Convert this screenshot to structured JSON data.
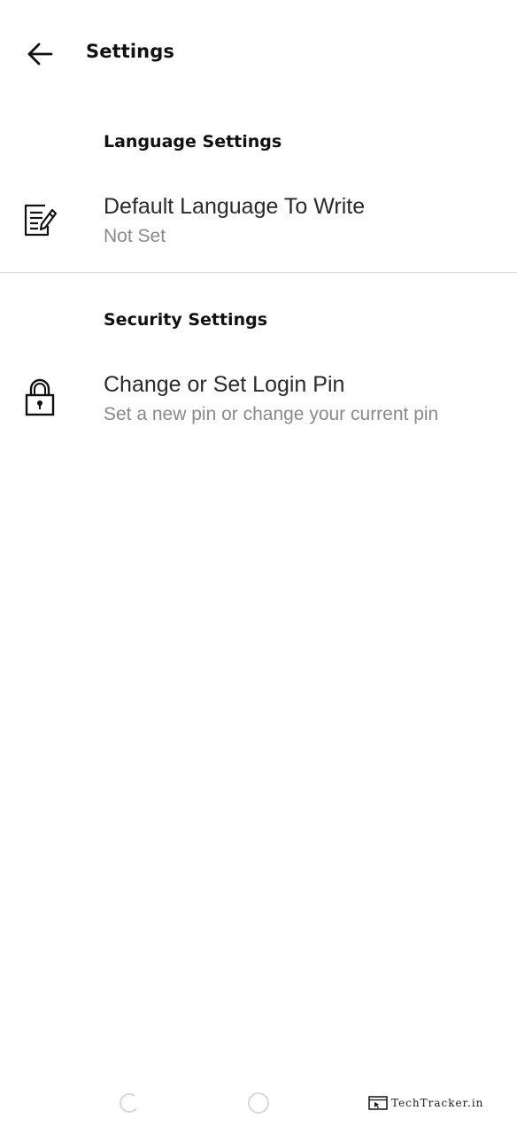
{
  "header": {
    "title": "Settings",
    "back_icon": "arrow-left-icon"
  },
  "sections": [
    {
      "header": "Language Settings",
      "items": [
        {
          "icon": "note-edit-icon",
          "title": "Default Language To Write",
          "summary": "Not Set"
        }
      ]
    },
    {
      "header": "Security Settings",
      "items": [
        {
          "icon": "lock-icon",
          "title": "Change or Set Login Pin",
          "summary": "Set a new pin or change your current pin"
        }
      ]
    }
  ],
  "nav_bar": {
    "recent_icon": "recent-apps-icon",
    "home_icon": "home-icon"
  },
  "watermark": {
    "text": "TechTracker.in"
  },
  "colors": {
    "background": "#ffffff",
    "title_text": "#111111",
    "summary_text": "#8a8a8a",
    "divider": "#dcdcdc"
  }
}
